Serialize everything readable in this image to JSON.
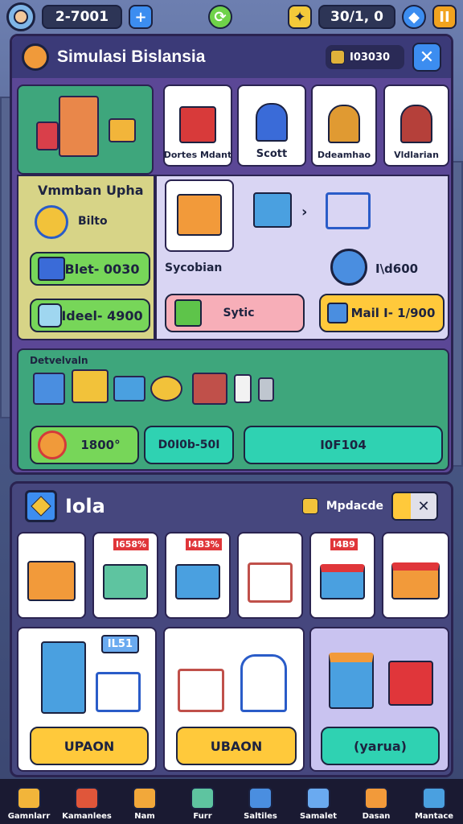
{
  "topbar": {
    "currency": "2-7001",
    "plus_label": "+",
    "stats": "30/1, 0",
    "pause_label": "II"
  },
  "header": {
    "title": "Simulasi Bislansia",
    "coins": "I03030",
    "close_label": "✕"
  },
  "characters": [
    {
      "label": "Dortes Mdant"
    },
    {
      "label": "Scott"
    },
    {
      "label": "Ddeamhao"
    },
    {
      "label": "Vldlarian"
    }
  ],
  "store_panel": {
    "heading": "Vmmban Upha",
    "item1_label": "Bilto",
    "btn1_label": "Blet- 0030",
    "btn2_label": "Ideel- 4900"
  },
  "shop_panel": {
    "item_label": "Sycobian",
    "gift_label": "Sytic",
    "value_label": "I\\d600",
    "main_label": "Mail I- 1/900"
  },
  "inventory": {
    "heading": "Detvelvaln",
    "coin_value": "1800°",
    "middle_value": "D0I0b-50I",
    "right_value": "I0F104"
  },
  "market": {
    "title": "Iola",
    "upgrade_label": "Mpdacde",
    "close_label": "✕",
    "badges": [
      "I658%",
      "I4B3%",
      "I4B9"
    ],
    "big_badge": "IL51",
    "big_btn1": "UPAON",
    "big_btn2": "UBAON",
    "big_btn3": "(yarua)"
  },
  "nav": [
    {
      "label": "Gamnlarr"
    },
    {
      "label": "Kamanlees"
    },
    {
      "label": "Nam"
    },
    {
      "label": "Furr"
    },
    {
      "label": "Saltiles"
    },
    {
      "label": "Samalet"
    },
    {
      "label": "Dasan"
    },
    {
      "label": "Mantace"
    }
  ],
  "colors": {
    "panel_green": "#3ea67c",
    "panel_yellow": "#d7d487",
    "panel_lavender": "#d9d5f3",
    "button_green": "#77d659",
    "button_yellow": "#ffc93b",
    "button_teal": "#2fd2b2",
    "frame_purple": "#6b4fa3",
    "nav_dark": "#1a1a32"
  }
}
